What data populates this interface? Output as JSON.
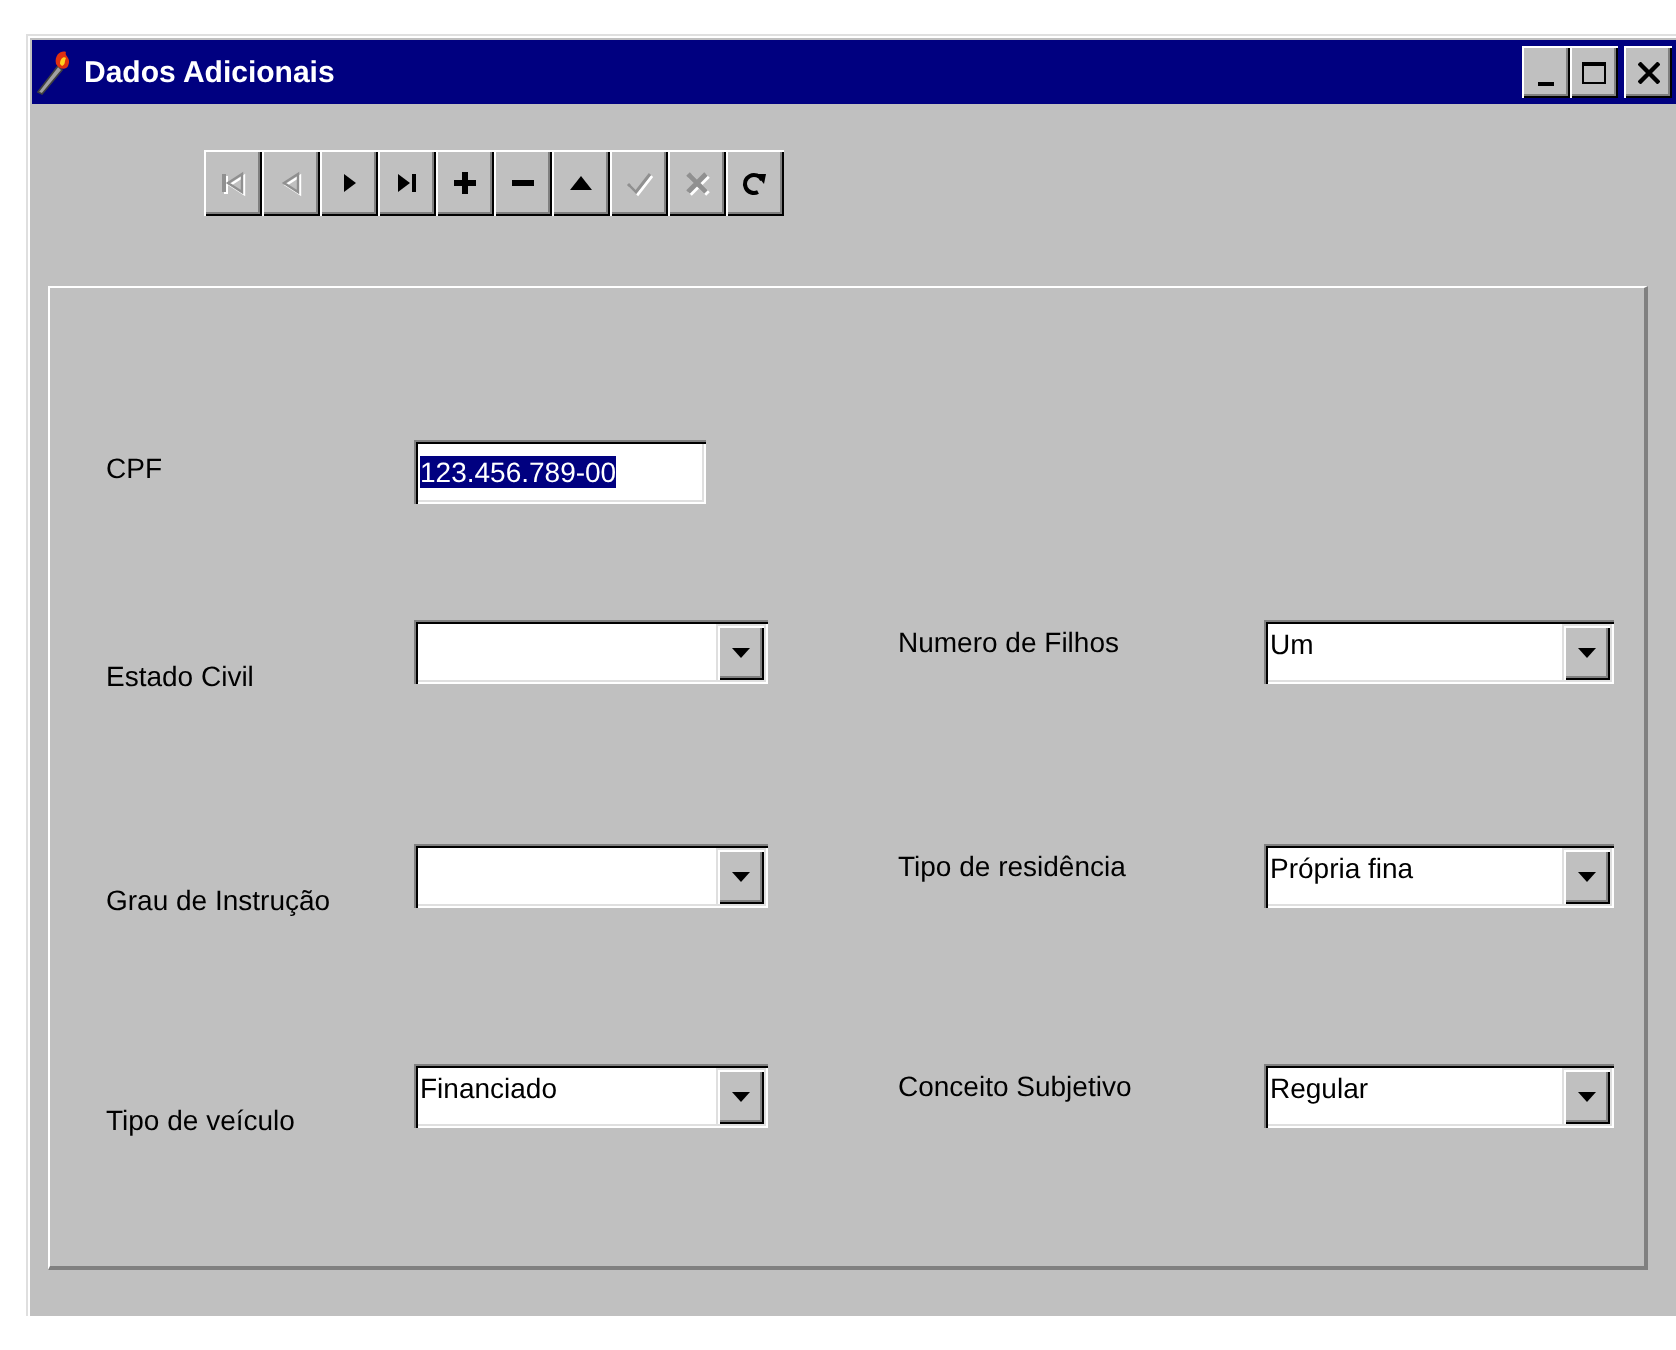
{
  "window": {
    "title": "Dados Adicionais",
    "controls": [
      {
        "kind": "minimize"
      },
      {
        "kind": "maximize"
      },
      {
        "kind": "close"
      }
    ]
  },
  "navigator": [
    {
      "kind": "first",
      "disabled": true
    },
    {
      "kind": "prior",
      "disabled": true
    },
    {
      "kind": "next",
      "disabled": false
    },
    {
      "kind": "last",
      "disabled": false
    },
    {
      "kind": "insert",
      "disabled": false
    },
    {
      "kind": "delete",
      "disabled": false
    },
    {
      "kind": "edit",
      "disabled": false
    },
    {
      "kind": "post",
      "disabled": true
    },
    {
      "kind": "cancel",
      "disabled": true
    },
    {
      "kind": "refresh",
      "disabled": false
    }
  ],
  "form": {
    "rows": [
      [
        {
          "label": "CPF",
          "kind": "text",
          "value": "123.456.789-00",
          "highlighted": true
        }
      ],
      [
        {
          "label": "Estado Civil",
          "kind": "combo"
        },
        {
          "label": "Numero de Filhos",
          "kind": "combo",
          "value": "Um"
        }
      ],
      [
        {
          "label": "Grau de Instrução",
          "kind": "combo"
        },
        {
          "label": "Tipo de residência",
          "kind": "combo",
          "value": "Própria fina"
        }
      ],
      [
        {
          "label": "Tipo de veículo",
          "kind": "combo",
          "value": "Financiado"
        },
        {
          "label": "Conceito Subjetivo",
          "kind": "combo",
          "value": "Regular"
        }
      ]
    ]
  }
}
